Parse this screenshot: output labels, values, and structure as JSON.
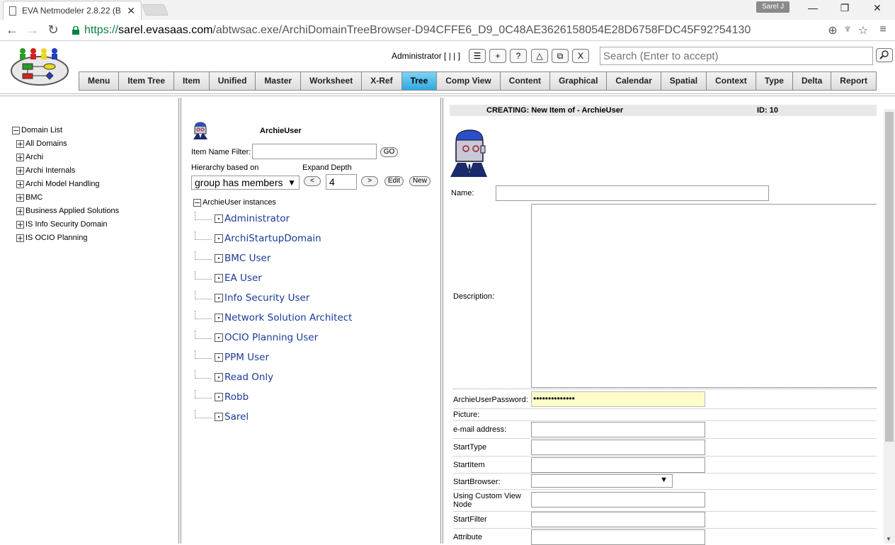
{
  "browser": {
    "tab_title": "EVA Netmodeler 2.8.22 (B",
    "tab_close": "✕",
    "profile": "Sarel J",
    "url_scheme": "https://",
    "url_host": "sarel.evasaas.com",
    "url_path": "/abtwsac.exe/ArchiDomainTreeBrowser-D94CFFE6_D9_0C48AE3626158054E28D6758FDC45F92?54130"
  },
  "header": {
    "admin": "Administrator [ | | ]",
    "tools": [
      "☰",
      "+",
      "?",
      "△",
      "⧉",
      "X"
    ],
    "search_placeholder": "Search (Enter to accept)"
  },
  "nav_tabs": [
    {
      "label": "Menu",
      "active": false
    },
    {
      "label": "Item Tree",
      "active": false
    },
    {
      "label": "Item",
      "active": false
    },
    {
      "label": "Unified",
      "active": false
    },
    {
      "label": "Master",
      "active": false
    },
    {
      "label": "Worksheet",
      "active": false
    },
    {
      "label": "X-Ref",
      "active": false
    },
    {
      "label": "Tree",
      "active": true
    },
    {
      "label": "Comp View",
      "active": false
    },
    {
      "label": "Content",
      "active": false
    },
    {
      "label": "Graphical",
      "active": false
    },
    {
      "label": "Calendar",
      "active": false
    },
    {
      "label": "Spatial",
      "active": false
    },
    {
      "label": "Context",
      "active": false
    },
    {
      "label": "Type",
      "active": false
    },
    {
      "label": "Delta",
      "active": false
    },
    {
      "label": "Report",
      "active": false
    }
  ],
  "domains": {
    "root": "Domain List",
    "items": [
      "All Domains",
      "Archi",
      "Archi Internals",
      "Archi Model Handling",
      "BMC",
      "Business Applied Solutions",
      "IS Info Security Domain",
      "IS OCIO Planning"
    ]
  },
  "browser_panel": {
    "title": "ArchieUser",
    "filter_label": "Item Name Filter:",
    "filter_value": "",
    "go": "GO",
    "hierarchy_label": "Hierarchy based on",
    "hierarchy_value": "group has members",
    "depth_label": "Expand Depth",
    "depth_value": "4",
    "prev": "<",
    "next": ">",
    "edit": "Edit",
    "new": "New",
    "instances_root": "ArchieUser instances",
    "instances": [
      "Administrator",
      "ArchiStartupDomain",
      "BMC User",
      "EA User",
      "Info Security User",
      "Network Solution Architect",
      "OCIO Planning User",
      "PPM User",
      "Read Only",
      "Robb",
      "Sarel"
    ]
  },
  "form": {
    "creating": "CREATING:  New Item of - ArchieUser",
    "id": "ID: 10",
    "name_label": "Name:",
    "name_value": "",
    "description_label": "Description:",
    "password_label": "ArchieUserPassword:",
    "password_value": "••••••••••••••",
    "picture_label": "Picture:",
    "email_label": "e-mail address:",
    "starttype_label": "StartType",
    "startitem_label": "StartItem",
    "startbrowser_label": "StartBrowser:",
    "startbrowser_value": "",
    "customview_label": "Using Custom View Node",
    "startfilter_label": "StartFilter",
    "attribute_label": "Attribute"
  }
}
